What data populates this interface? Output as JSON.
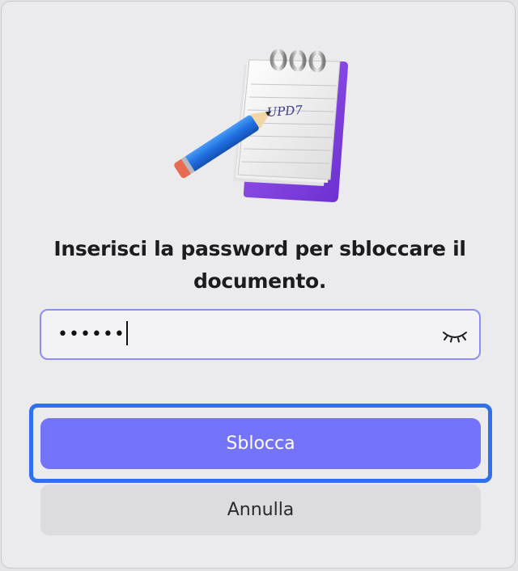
{
  "dialog": {
    "icon": "notepad-pencil-icon",
    "icon_label": "UPD7",
    "prompt": "Inserisci la password per sbloccare il documento.",
    "password": {
      "masked_value": "••••••",
      "toggle_icon": "eye-closed-icon"
    },
    "unlock_label": "Sblocca",
    "cancel_label": "Annulla"
  },
  "colors": {
    "accent": "#7474fa",
    "focus_ring": "#2f6ff0",
    "field_border": "#8e8ef2",
    "notepad_back": "#8a3fe0"
  }
}
